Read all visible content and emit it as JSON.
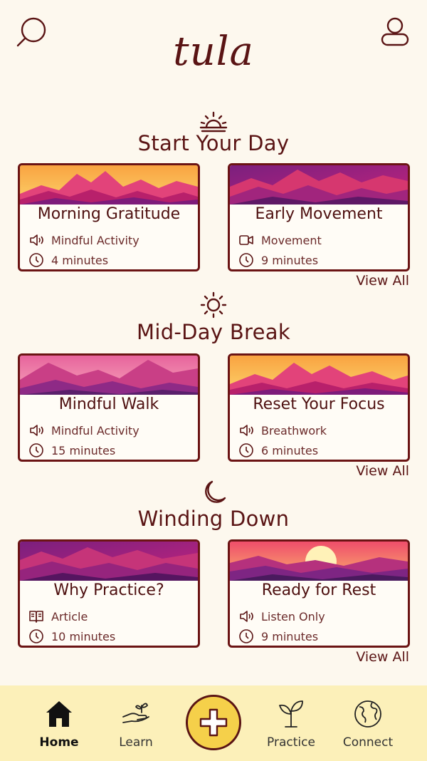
{
  "app": {
    "logo_text": "tula"
  },
  "colors": {
    "background": "#fdf8ee",
    "brand": "#5a1414",
    "nav_bg": "#fcf0b9",
    "add_button": "#f5d04a"
  },
  "sections": [
    {
      "title": "Start Your Day",
      "icon": "sunrise-icon",
      "view_all": "View All",
      "cards": [
        {
          "title": "Morning Gratitude",
          "type_icon": "speaker-icon",
          "type": "Mindful Activity",
          "duration": "4 minutes"
        },
        {
          "title": "Early Movement",
          "type_icon": "video-icon",
          "type": "Movement",
          "duration": "9 minutes"
        }
      ]
    },
    {
      "title": "Mid-Day Break",
      "icon": "sun-icon",
      "view_all": "View All",
      "cards": [
        {
          "title": "Mindful Walk",
          "type_icon": "speaker-icon",
          "type": "Mindful Activity",
          "duration": "15 minutes"
        },
        {
          "title": "Reset Your Focus",
          "type_icon": "speaker-icon",
          "type": "Breathwork",
          "duration": "6 minutes"
        }
      ]
    },
    {
      "title": "Winding Down",
      "icon": "moon-icon",
      "view_all": "View All",
      "cards": [
        {
          "title": "Why Practice?",
          "type_icon": "book-icon",
          "type": "Article",
          "duration": "10 minutes"
        },
        {
          "title": "Ready for Rest",
          "type_icon": "speaker-icon",
          "type": "Listen Only",
          "duration": "9 minutes"
        }
      ]
    }
  ],
  "nav": {
    "items": [
      {
        "label": "Home",
        "icon": "home-icon",
        "active": true
      },
      {
        "label": "Learn",
        "icon": "hand-sprout-icon"
      },
      {
        "label": "Practice",
        "icon": "sprout-icon"
      },
      {
        "label": "Connect",
        "icon": "globe-icon"
      }
    ],
    "center_icon": "plus-icon"
  }
}
